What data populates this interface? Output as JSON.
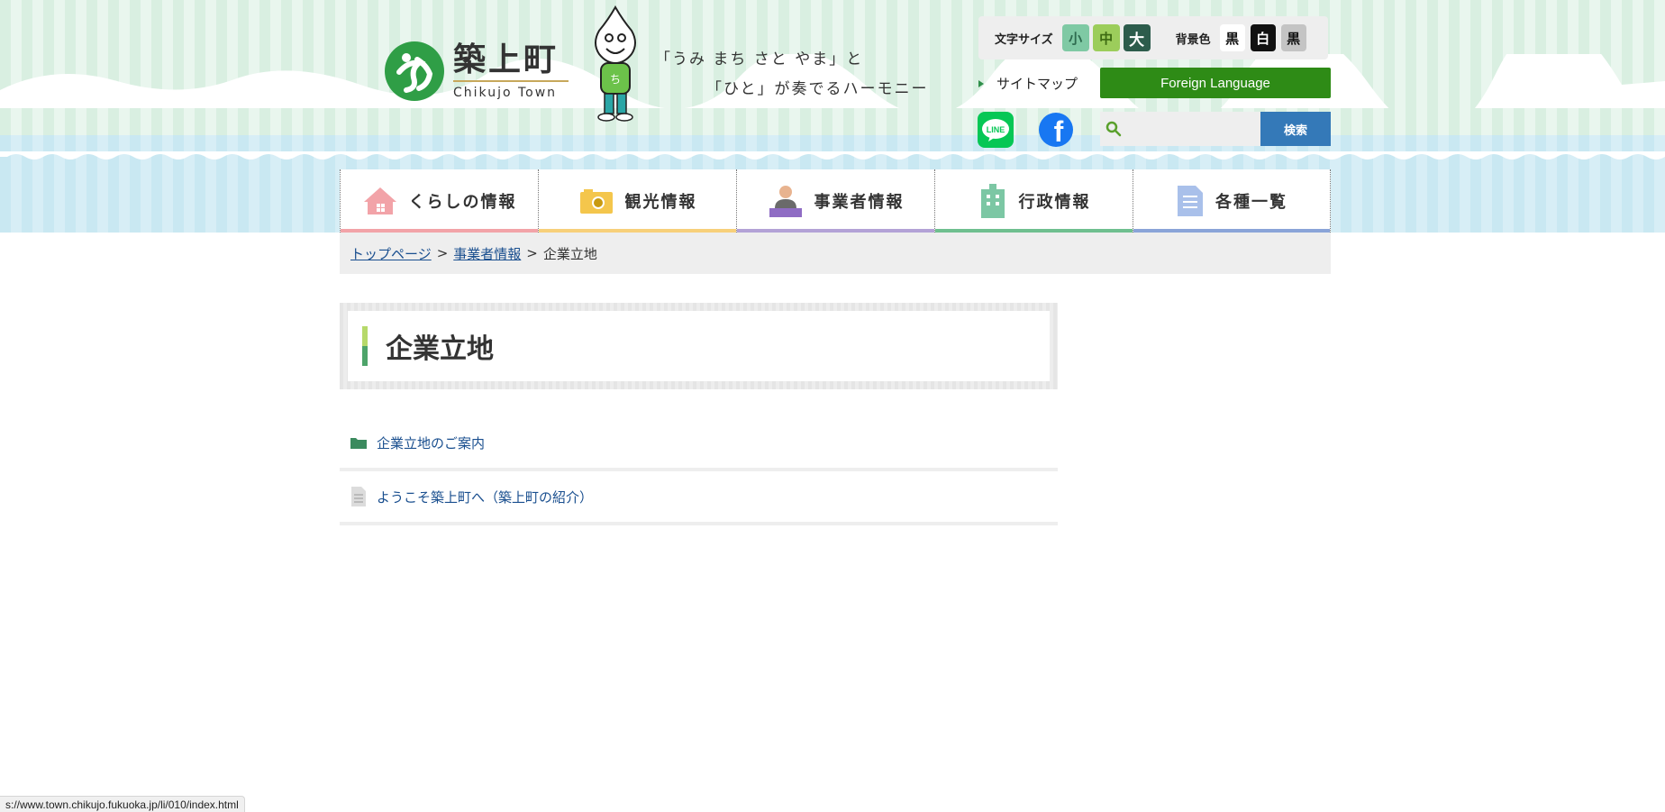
{
  "header": {
    "logo_jp": "築上町",
    "logo_en": "Chikujo Town",
    "catch_line1": "「うみ まち さと やま」と",
    "catch_line2": "「ひと」が奏でるハーモニー"
  },
  "text_size": {
    "label": "文字サイズ",
    "small": "小",
    "medium": "中",
    "large": "大"
  },
  "bg_color": {
    "label": "背景色",
    "options": [
      "黒",
      "白",
      "黒"
    ]
  },
  "utility": {
    "sitemap": "サイトマップ",
    "foreign_language": "Foreign Language",
    "line_label": "LINE",
    "facebook_label": "f"
  },
  "search": {
    "placeholder": "",
    "button": "検索"
  },
  "nav": {
    "items": [
      {
        "label": "くらしの情報",
        "color": "#f2a3a8"
      },
      {
        "label": "観光情報",
        "color": "#f7d07a"
      },
      {
        "label": "事業者情報",
        "color": "#b3a2d6"
      },
      {
        "label": "行政情報",
        "color": "#6fbf8f"
      },
      {
        "label": "各種一覧",
        "color": "#8aa4d8"
      }
    ]
  },
  "breadcrumb": {
    "home": "トップページ",
    "parent": "事業者情報",
    "current": "企業立地"
  },
  "page": {
    "title": "企業立地"
  },
  "list": {
    "items": [
      {
        "label": "企業立地のご案内",
        "icon": "folder-icon"
      },
      {
        "label": "ようこそ築上町へ（築上町の紹介）",
        "icon": "document-icon"
      }
    ]
  },
  "status_bar": {
    "url": "s://www.town.chikujo.fukuoka.jp/li/010/index.html"
  }
}
